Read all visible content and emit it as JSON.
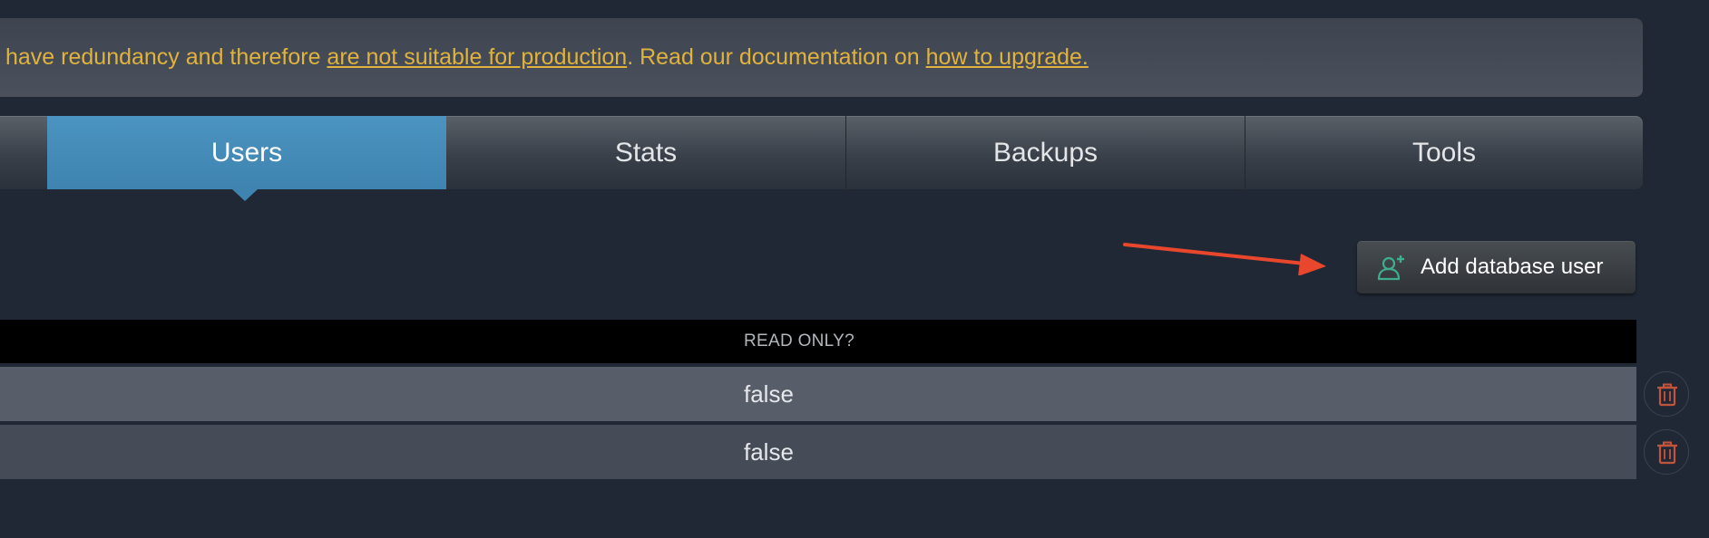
{
  "banner": {
    "text_before": "have redundancy and therefore ",
    "link1": "are not suitable for production",
    "text_middle": ". Read our documentation on ",
    "link2": "how to upgrade."
  },
  "tabs": [
    {
      "label": "Users",
      "active": true
    },
    {
      "label": "Stats",
      "active": false
    },
    {
      "label": "Backups",
      "active": false
    },
    {
      "label": "Tools",
      "active": false
    }
  ],
  "actions": {
    "add_user_label": "Add database user",
    "add_user_icon": "add-user-icon"
  },
  "table": {
    "columns": [
      "READ ONLY?"
    ],
    "rows": [
      {
        "read_only": "false",
        "action_icon": "trash-icon"
      },
      {
        "read_only": "false",
        "action_icon": "trash-icon"
      }
    ]
  },
  "colors": {
    "background": "#212835",
    "warning_text": "#e0b23e",
    "active_tab": "#4389b6",
    "annotation_arrow": "#e8472e",
    "add_icon": "#3fae8e",
    "delete_icon": "#c2543c"
  }
}
